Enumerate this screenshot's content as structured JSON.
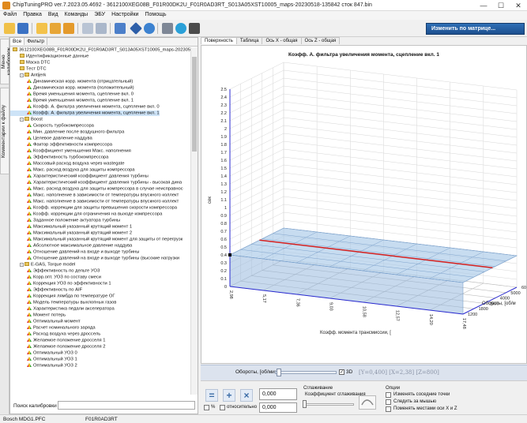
{
  "window": {
    "title": "ChipTuningPRO ver.7.2023.05.4692 - 3612100XEG08B_F01R00DK2U_F01R0AD3RT_S013A05XST10005_maps-20230518-135842 сток 847.bin",
    "min": "—",
    "max": "☐",
    "close": "✕"
  },
  "menu": [
    "Файл",
    "Правка",
    "Вид",
    "Команды",
    "ЭБУ",
    "Настройки",
    "Помощь"
  ],
  "toolbar": {
    "matrix_button": "Изменить по матрице..."
  },
  "side_tabs": [
    "Меню калибровок",
    "Комментарии к файлу"
  ],
  "left_tabs": [
    "Все",
    "Фильтр"
  ],
  "tree": [
    {
      "level": 0,
      "icon": "ecu",
      "text": "3612100XEG08B_F01R00DK2U_F01R0AD3RT_S013A05XST10005_maps-20230518"
    },
    {
      "level": 1,
      "icon": "doc",
      "text": "Идентификационные данные"
    },
    {
      "level": 1,
      "icon": "doc",
      "text": "Маска DTC"
    },
    {
      "level": 1,
      "icon": "doc",
      "text": "Тест DTC"
    },
    {
      "level": 1,
      "icon": "folder",
      "expand": "-",
      "text": "Antijerk"
    },
    {
      "level": 2,
      "icon": "map",
      "text": "Динамическая корр. момента (отрицательный)"
    },
    {
      "level": 2,
      "icon": "map",
      "text": "Динамическая корр. момента (положительный)"
    },
    {
      "level": 2,
      "icon": "map",
      "text": "Время уменьшения момента, сцепление вкл. 0"
    },
    {
      "level": 2,
      "icon": "map",
      "text": "Время уменьшения момента, сцепление вкл. 1"
    },
    {
      "level": 2,
      "icon": "map",
      "text": "Коэфф. А. фильтра увеличения момента, сцепление вкл. 0"
    },
    {
      "level": 2,
      "icon": "map",
      "text": "Коэфф. А. фильтра увеличения момента, сцепление вкл. 1",
      "selected": true
    },
    {
      "level": 1,
      "icon": "folder",
      "expand": "-",
      "text": "Boost"
    },
    {
      "level": 2,
      "icon": "map",
      "text": "Скорость турбокомпрессора"
    },
    {
      "level": 2,
      "icon": "map",
      "text": "Мин. давление после воздушного фильтра"
    },
    {
      "level": 2,
      "icon": "map",
      "text": "Целевое давление наддува"
    },
    {
      "level": 2,
      "icon": "map",
      "text": "Фактор эффективности компрессора"
    },
    {
      "level": 2,
      "icon": "map",
      "text": "Коэффициент уменьшения Макс. наполнения"
    },
    {
      "level": 2,
      "icon": "map",
      "text": "Эффективность турбокомпрессора"
    },
    {
      "level": 2,
      "icon": "map",
      "text": "Массовый расход воздуха через wastegate"
    },
    {
      "level": 2,
      "icon": "map",
      "text": "Макс. расход воздуха для защиты компрессора"
    },
    {
      "level": 2,
      "icon": "map",
      "text": "Характеристический коэффициент давления турбины"
    },
    {
      "level": 2,
      "icon": "map",
      "text": "Характеристический коэффициент давления турбины - высокая дина"
    },
    {
      "level": 2,
      "icon": "map",
      "text": "Макс. расход воздуха для защиты компрессора в случае неисправнос"
    },
    {
      "level": 2,
      "icon": "map",
      "text": "Макс. наполнение в зависимости от температуры впускного коллект"
    },
    {
      "level": 2,
      "icon": "map",
      "text": "Макс. наполнение в зависимости от температуры впускного коллект"
    },
    {
      "level": 2,
      "icon": "map",
      "text": "Коэфф. коррекции для защиты превышения скорости компрессора"
    },
    {
      "level": 2,
      "icon": "map",
      "text": "Коэфф. коррекции для ограничения на выходе компрессора"
    },
    {
      "level": 2,
      "icon": "map",
      "text": "Заданное положение актуатора турбины"
    },
    {
      "level": 2,
      "icon": "map",
      "text": "Максимальный указанный крутящий момент 1"
    },
    {
      "level": 2,
      "icon": "map",
      "text": "Максимальный указанный крутящий момент 2"
    },
    {
      "level": 2,
      "icon": "map",
      "text": "Максимальный указанный крутящий момент для защиты от перегрузк"
    },
    {
      "level": 2,
      "icon": "map",
      "text": "Абсолютное максимальное давление наддува"
    },
    {
      "level": 2,
      "icon": "map",
      "text": "Отношение давлений на входе и выходе турбины"
    },
    {
      "level": 2,
      "icon": "map",
      "text": "Отношение давлений на входе и выходе турбины (высокие нагрузки"
    },
    {
      "level": 1,
      "icon": "folder",
      "expand": "-",
      "text": "E-GAS, Torque model"
    },
    {
      "level": 2,
      "icon": "map",
      "text": "Эффективность по дельте УОЗ"
    },
    {
      "level": 2,
      "icon": "map",
      "text": "Корр.опт. УОЗ по составу смеси"
    },
    {
      "level": 2,
      "icon": "map",
      "text": "Коррекция УОЗ по эффективности 1"
    },
    {
      "level": 2,
      "icon": "map",
      "text": "Эффективность по AIF"
    },
    {
      "level": 2,
      "icon": "map",
      "text": "Коррекция лямбда по температуре ОГ"
    },
    {
      "level": 2,
      "icon": "map",
      "text": "Модель температуры выхлопных газов"
    },
    {
      "level": 2,
      "icon": "map",
      "text": "Характеристика педали акселератора"
    },
    {
      "level": 2,
      "icon": "map",
      "text": "Момент потерь"
    },
    {
      "level": 2,
      "icon": "map",
      "text": "Оптимальный момент"
    },
    {
      "level": 2,
      "icon": "map",
      "text": "Расчет номинального заряда"
    },
    {
      "level": 2,
      "icon": "map",
      "text": "Расход воздуха через дроссель"
    },
    {
      "level": 2,
      "icon": "map",
      "text": "Желаемое положение дросселя 1"
    },
    {
      "level": 2,
      "icon": "map",
      "text": "Желаемое положение дросселя 2"
    },
    {
      "level": 2,
      "icon": "map",
      "text": "Оптимальный УОЗ 0"
    },
    {
      "level": 2,
      "icon": "map",
      "text": "Оптимальный УОЗ 1"
    },
    {
      "level": 2,
      "icon": "map",
      "text": "Оптимальный УОЗ 2"
    }
  ],
  "search_label": "Поиск калибровки",
  "right_tabs": [
    "Поверхность",
    "Таблица",
    "Ось X - общая",
    "Ось Z - общая"
  ],
  "chart_data": {
    "type": "surface",
    "title": "Коэфф. А. фильтра увеличения момента, сцепление вкл. 1",
    "ylabel": "сек",
    "xlabel": "Коэфф. момента трансмиссии, [",
    "zlabel": "Обороты, [об/м",
    "y_ticks": [
      "0",
      "0.1",
      "0.2",
      "0.3",
      "0.4",
      "0.5",
      "0.6",
      "0.7",
      "0.8",
      "0.9",
      "1",
      "1.1",
      "1.2",
      "1.3",
      "1.4",
      "1.5",
      "1.6",
      "1.7",
      "1.8",
      "1.9",
      "2",
      "2.1",
      "2.2",
      "2.3",
      "2.4",
      "2.5"
    ],
    "ylim": [
      0,
      2.5
    ],
    "x_ticks": [
      "2,98",
      "5,17",
      "7,36",
      "9,03",
      "10,58",
      "12,57",
      "14,20",
      "17,48"
    ],
    "z_ticks": [
      "1200",
      "1800",
      "2500",
      "4000",
      "5000",
      "6000"
    ],
    "surface_value": 0.4,
    "series": [
      {
        "name": "row",
        "color": "#d42020",
        "values": [
          0.4,
          0.4,
          0.4,
          0.4,
          0.4,
          0.4,
          0.4,
          0.4
        ]
      }
    ]
  },
  "slider": {
    "label": "Обороты, [об/мин]",
    "check_3d": "3D",
    "coords": "[Y=0,400] [X=2,38] [Z=800]"
  },
  "edit": {
    "value": "0,000",
    "value2": "0,000",
    "percent": "%",
    "relative": "относительно",
    "smoothing": "Сглаживание",
    "smoothing_coef": "Коэффициент сглаживания",
    "options": "Опции",
    "opt1": "Изменять соседние точки",
    "opt2": "Следить за мышью",
    "opt3": "Поменять местами оси X и Z"
  },
  "status": [
    "Bosch MDG1.PFC",
    "F01R0AD3RT"
  ]
}
